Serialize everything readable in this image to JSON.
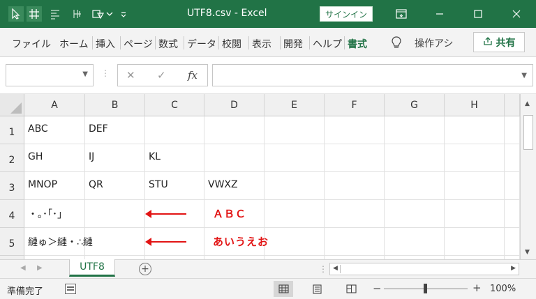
{
  "titlebar": {
    "title": "UTF8.csv  -  Excel",
    "signin_label": "サインイン",
    "icons": [
      "select-icon",
      "grid-icon",
      "text-icon",
      "pinyin-icon",
      "shape-icon",
      "dropdown-icon",
      "customize-icon"
    ],
    "window": {
      "ribbon_display": "⊡",
      "minimize": "—",
      "maximize": "☐",
      "close": "✕"
    }
  },
  "ribbon": {
    "tabs": [
      "ファイル",
      "ホーム",
      "挿入",
      "ページ",
      "数式",
      "データ",
      "校閲",
      "表示",
      "開発",
      "ヘルプ",
      "書式"
    ],
    "active_tab": "書式",
    "tell_me": "操作アシ",
    "share_label": "共有",
    "accent_color": "#217346"
  },
  "formula_bar": {
    "name_box_value": "",
    "formula_value": "",
    "cancel_symbol": "✕",
    "enter_symbol": "✓",
    "fx_label": "fx"
  },
  "grid": {
    "columns": [
      "A",
      "B",
      "C",
      "D",
      "E",
      "F",
      "G",
      "H"
    ],
    "rows": [
      "1",
      "2",
      "3",
      "4",
      "5"
    ],
    "cells": {
      "A1": "ABC",
      "B1": "DEF",
      "A2": "GH",
      "B2": "IJ",
      "C2": "KL",
      "A3": "MNOP",
      "B3": "QR",
      "C3": "STU",
      "D3": "VWXZ",
      "A4": "・｡･｢･｣",
      "A5": "縺ゅ＞縺・∴縺"
    },
    "annotations": {
      "row4_label": "ＡＢＣ",
      "row5_label": "あいうえお",
      "color": "#e21414"
    }
  },
  "sheets": {
    "tabs": [
      "UTF8"
    ],
    "active": "UTF8",
    "add_symbol": "+"
  },
  "status": {
    "ready_text": "準備完了",
    "zoom_label": "100%",
    "zoom_minus": "−",
    "zoom_plus": "+"
  }
}
